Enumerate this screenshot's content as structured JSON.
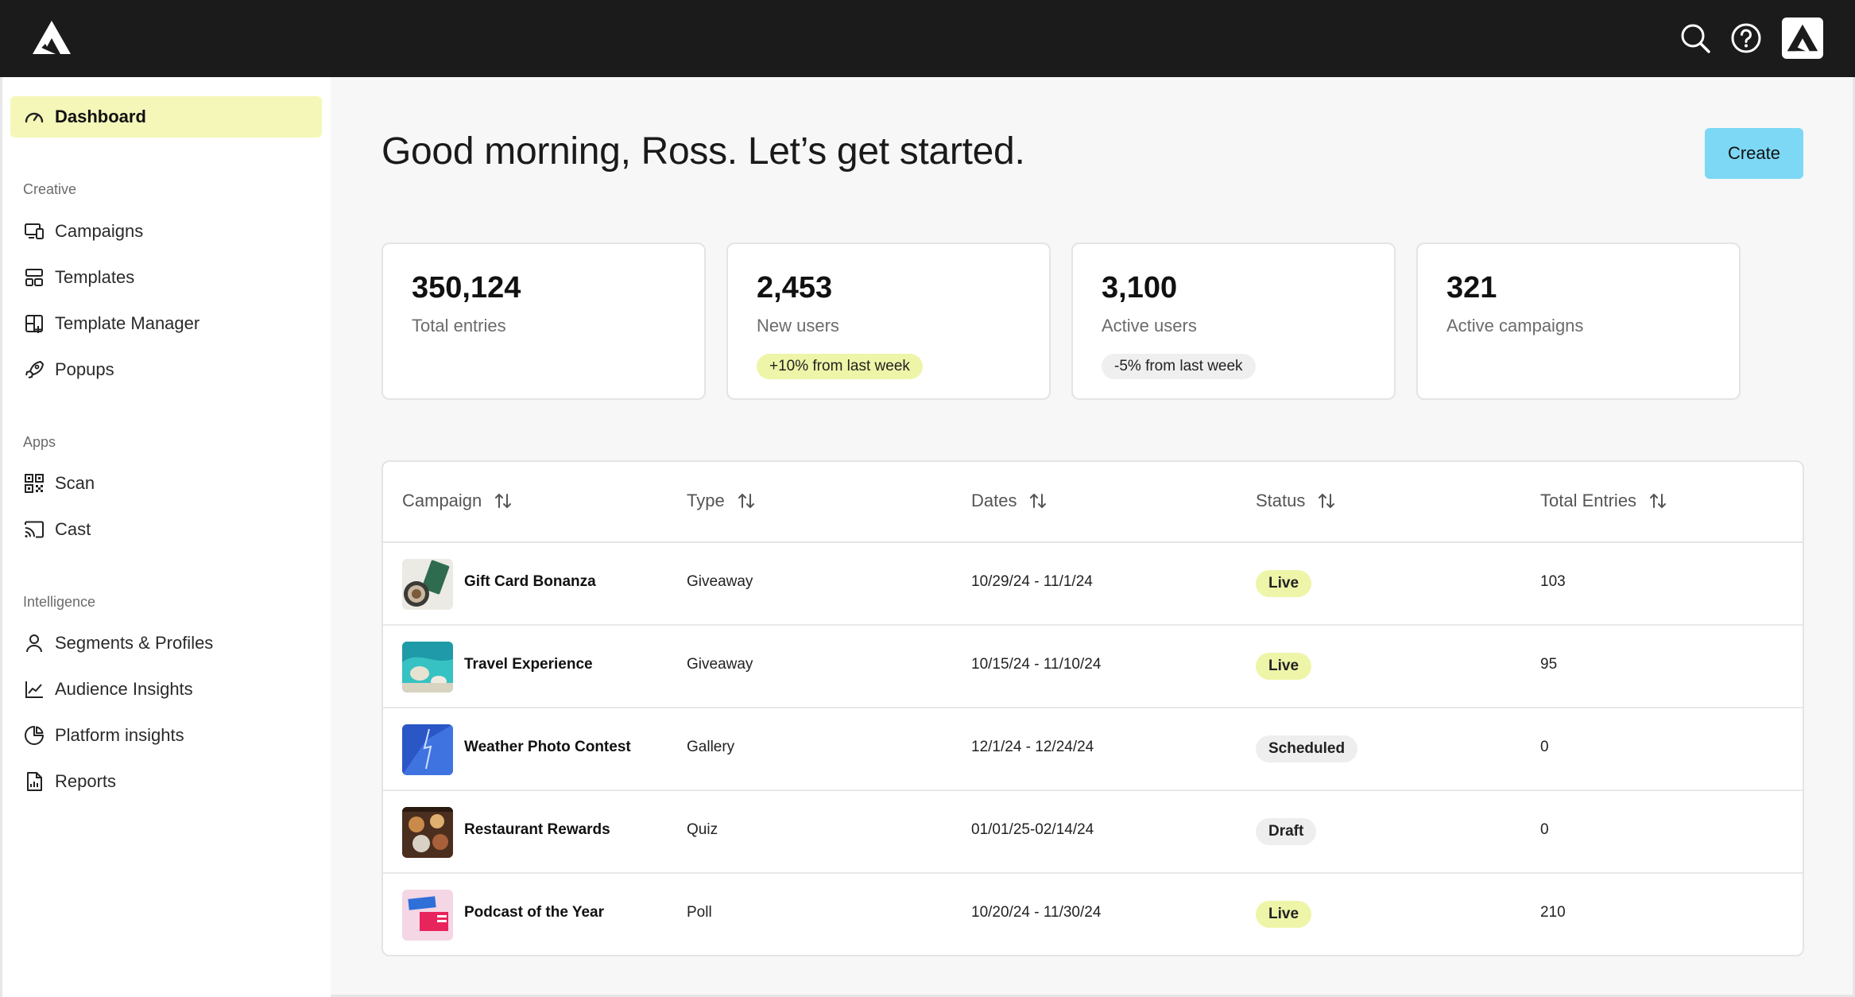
{
  "header": {
    "logo": "brand-logo-icon",
    "actions": [
      "search-icon",
      "help-icon",
      "avatar-logo-icon"
    ]
  },
  "sidebar": {
    "dashboard": "Dashboard",
    "sections": [
      {
        "label": "Creative",
        "items": [
          "Campaigns",
          "Templates",
          "Template Manager",
          "Popups"
        ]
      },
      {
        "label": "Apps",
        "items": [
          "Scan",
          "Cast"
        ]
      },
      {
        "label": "Intelligence",
        "items": [
          "Segments & Profiles",
          "Audience Insights",
          "Platform insights",
          "Reports"
        ]
      }
    ]
  },
  "main": {
    "greeting": "Good morning, Ross. Let’s get started.",
    "create_label": "Create",
    "stats": [
      {
        "value": "350,124",
        "label": "Total entries",
        "badge": ""
      },
      {
        "value": "2,453",
        "label": "New users",
        "badge": "+10% from last week"
      },
      {
        "value": "3,100",
        "label": "Active users",
        "badge": "-5% from last week"
      },
      {
        "value": "321",
        "label": "Active campaigns",
        "badge": ""
      }
    ],
    "table": {
      "columns": [
        "Campaign",
        "Type",
        "Dates",
        "Status",
        "Total Entries"
      ],
      "rows": [
        {
          "campaign": "Gift Card Bonanza",
          "type": "Giveaway",
          "dates": "10/29/24 - 11/1/24",
          "status": "Live",
          "entries": "103"
        },
        {
          "campaign": "Travel Experience",
          "type": "Giveaway",
          "dates": "10/15/24 - 11/10/24",
          "status": "Live",
          "entries": "95"
        },
        {
          "campaign": "Weather Photo Contest",
          "type": "Gallery",
          "dates": "12/1/24 - 12/24/24",
          "status": "Scheduled",
          "entries": "0"
        },
        {
          "campaign": "Restaurant Rewards",
          "type": "Quiz",
          "dates": "01/01/25-02/14/24",
          "status": "Draft",
          "entries": "0"
        },
        {
          "campaign": "Podcast of the Year",
          "type": "Poll",
          "dates": "10/20/24 - 11/30/24",
          "status": "Live",
          "entries": "210"
        }
      ]
    }
  },
  "colors": {
    "topbar": "#1b1b1b",
    "active_nav": "#f4f7b8",
    "create_button": "#7dd8f5",
    "live_pill": "#eef5a8"
  }
}
